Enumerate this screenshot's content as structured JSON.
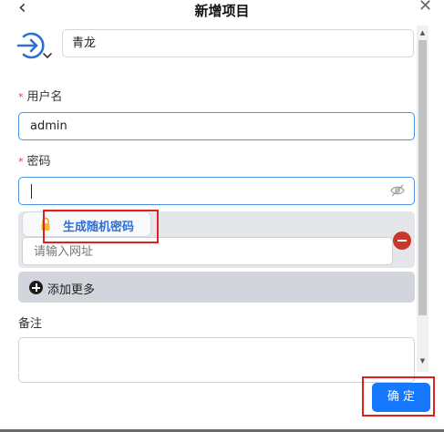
{
  "header": {
    "title": "新增项目",
    "back_icon": "chevron-left-icon",
    "close_icon": "close-icon"
  },
  "app": {
    "icon": "login-arrow-icon",
    "name_value": "青龙"
  },
  "username": {
    "label": "用户名",
    "required_mark": "*",
    "value": "admin"
  },
  "password": {
    "label": "密码",
    "required_mark": "*",
    "value": "",
    "visibility_icon": "eye-off-icon"
  },
  "website": {
    "suggestion_label": "生成随机密码",
    "suggestion_icon": "lock-icon",
    "placeholder": "请输入网址",
    "remove_icon": "minus-circle-icon"
  },
  "add_more": {
    "label": "添加更多",
    "icon": "plus-circle-icon"
  },
  "note": {
    "label": "备注",
    "value": ""
  },
  "footer": {
    "confirm_label": "确 定"
  },
  "colors": {
    "accent": "#1677ff",
    "required": "#e03c3c",
    "remove": "#c9372c",
    "highlight": "#e02020"
  }
}
